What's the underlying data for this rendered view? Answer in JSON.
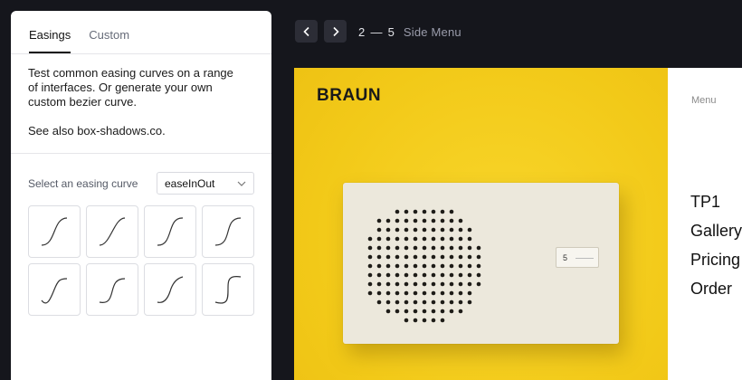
{
  "panel": {
    "tabs": [
      {
        "label": "Easings",
        "active": true
      },
      {
        "label": "Custom",
        "active": false
      }
    ],
    "description": "Test common easing curves on a range of interfaces. Or generate your own custom bezier curve.",
    "see_also": "See also box-shadows.co.",
    "picker_label": "Select an easing curve",
    "selected_curve": "easeInOut",
    "curve_tile_icons": [
      "ease-in-out-curve-icon",
      "ease-in-out-sine-curve-icon",
      "ease-in-out-steep-curve-icon",
      "ease-in-out-quart-curve-icon",
      "ease-in-out-back-curve-icon",
      "ease-in-out-expo-curve-icon",
      "ease-in-out-circ-curve-icon",
      "ease-in-out-sharp-curve-icon"
    ]
  },
  "topbar": {
    "prev_icon": "chevron-left-icon",
    "next_icon": "chevron-right-icon",
    "counter_start": "2",
    "counter_sep": "—",
    "counter_end": "5",
    "title": "Side Menu"
  },
  "preview": {
    "brand": "BRAUN",
    "dial_value": "5",
    "menu_label": "Menu",
    "menu_items": [
      "TP1",
      "Gallery",
      "Pricing",
      "Order"
    ],
    "background_color": "#f4cc1d"
  }
}
